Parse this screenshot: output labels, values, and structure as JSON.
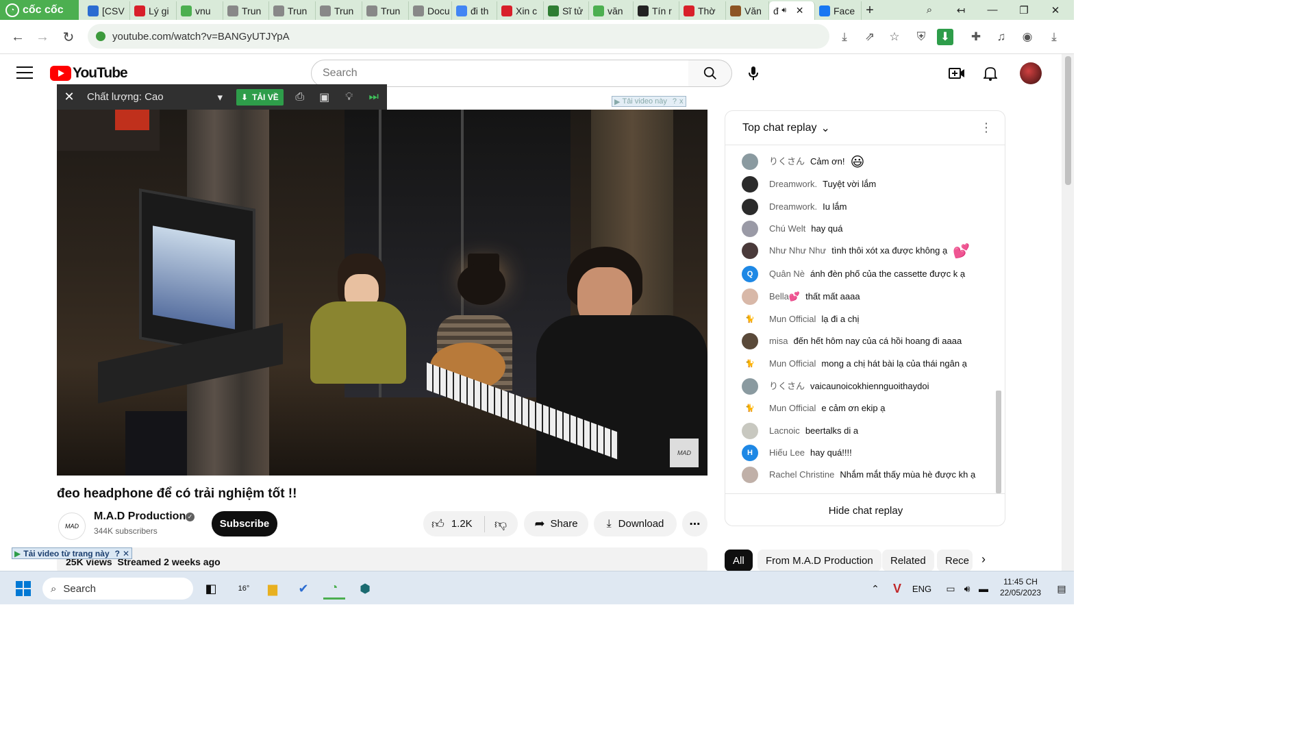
{
  "browser": {
    "brand": "cốc cốc",
    "tabs": [
      {
        "label": "[CSV",
        "icon_color": "#2b6cd1",
        "icon": "doc-icon"
      },
      {
        "label": "Lý gi",
        "icon_color": "#d8202a",
        "icon": "bookmark-icon"
      },
      {
        "label": "vnu",
        "icon_color": "#4caf50",
        "icon": "coccoc-icon"
      },
      {
        "label": "Trun",
        "icon_color": "#888888",
        "icon": "globe-icon"
      },
      {
        "label": "Trun",
        "icon_color": "#888888",
        "icon": "globe-icon"
      },
      {
        "label": "Trun",
        "icon_color": "#888888",
        "icon": "globe-icon"
      },
      {
        "label": "Trun",
        "icon_color": "#888888",
        "icon": "globe-icon"
      },
      {
        "label": "Docu",
        "icon_color": "#888888",
        "icon": "globe-icon"
      },
      {
        "label": "đi th",
        "icon_color": "#4285f4",
        "icon": "google-icon"
      },
      {
        "label": "Xin c",
        "icon_color": "#d8202a",
        "icon": "emblem-icon"
      },
      {
        "label": "Sĩ tử",
        "icon_color": "#2e7d32",
        "icon": "sheet-icon"
      },
      {
        "label": "văn",
        "icon_color": "#4caf50",
        "icon": "coccoc-icon"
      },
      {
        "label": "Tín r",
        "icon_color": "#222222",
        "icon": "wikipedia-icon"
      },
      {
        "label": "Thờ",
        "icon_color": "#d8202a",
        "icon": "emblem-icon"
      },
      {
        "label": "Văn",
        "icon_color": "#8d5524",
        "icon": "figure-icon"
      },
      {
        "label": "đ",
        "icon_color": "#ffffff",
        "icon": "audio-icon"
      },
      {
        "label": "Face",
        "icon_color": "#1877f2",
        "icon": "facebook-icon"
      }
    ],
    "url": "youtube.com/watch?v=BANGyUTJYpA"
  },
  "youtube": {
    "logo_text": "YouTube",
    "search_placeholder": "Search"
  },
  "downloader": {
    "quality": "Chất lượng: Cao",
    "download_label": "TẢI VỀ",
    "small_banner": "Tải video này",
    "page_banner": "Tải video từ trang này"
  },
  "video": {
    "title": "đeo headphone để có trải nghiệm tốt !!",
    "watermark": "MAD",
    "channel_name": "M.A.D Production",
    "channel_avatar_text": "MAD",
    "subscribers": "344K subscribers",
    "subscribe_label": "Subscribe",
    "likes": "1.2K",
    "share_label": "Share",
    "download_label": "Download",
    "views_line": "25K views  Streamed 2 weeks ago"
  },
  "chat": {
    "header": "Top chat replay",
    "footer": "Hide chat replay",
    "messages": [
      {
        "author": "りくさん",
        "text": "Cảm ơn!",
        "emoji": "😃",
        "av_color": "#8a9aa0",
        "av_text": ""
      },
      {
        "author": "Dreamwork.",
        "text": "Tuyệt vời lắm",
        "emoji": "",
        "av_color": "#2b2b2b",
        "av_text": ""
      },
      {
        "author": "Dreamwork.",
        "text": "Iu lắm",
        "emoji": "",
        "av_color": "#2b2b2b",
        "av_text": ""
      },
      {
        "author": "Chú Welt",
        "text": "hay quá",
        "emoji": "",
        "av_color": "#9a9aa6",
        "av_text": ""
      },
      {
        "author": "Như Như Như",
        "text": "tình thôi xót xa được không ạ",
        "emoji": "💕",
        "av_color": "#4a3a3a",
        "av_text": ""
      },
      {
        "author": "Quân Nè",
        "text": "ánh đèn phố của the cassette được k ạ",
        "emoji": "",
        "av_color": "#1e88e5",
        "av_text": "Q"
      },
      {
        "author": "Bella💕",
        "text": "thất mất aaaa",
        "emoji": "",
        "av_color": "#d8b8a8",
        "av_text": ""
      },
      {
        "author": "Mun Official",
        "text": "lạ đi a chị",
        "emoji": "",
        "av_color": "#ffffff",
        "av_text": "🐈"
      },
      {
        "author": "misa",
        "text": "đến hết hôm nay của cá hồi hoang đi aaaa",
        "emoji": "",
        "av_color": "#5a4a3a",
        "av_text": ""
      },
      {
        "author": "Mun Official",
        "text": "mong a chị hát bài lạ của thái ngân ạ",
        "emoji": "",
        "av_color": "#ffffff",
        "av_text": "🐈"
      },
      {
        "author": "りくさん",
        "text": "vaicaunoicokhiennguoithaydoi",
        "emoji": "",
        "av_color": "#8a9aa0",
        "av_text": ""
      },
      {
        "author": "Mun Official",
        "text": "e cảm ơn ekip ạ",
        "emoji": "",
        "av_color": "#ffffff",
        "av_text": "🐈"
      },
      {
        "author": "Lacnoic",
        "text": "beertalks di a",
        "emoji": "",
        "av_color": "#c8c8c0",
        "av_text": ""
      },
      {
        "author": "Hiếu Lee",
        "text": "hay quá!!!!",
        "emoji": "",
        "av_color": "#1e88e5",
        "av_text": "H"
      },
      {
        "author": "Rachel Christine",
        "text": "Nhắm mắt thấy mùa hè được kh ạ",
        "emoji": "",
        "av_color": "#c0b0a8",
        "av_text": ""
      }
    ]
  },
  "chips": [
    "All",
    "From M.A.D Production",
    "Related",
    "Rece"
  ],
  "taskbar": {
    "search_label": "Search",
    "weather": "16°",
    "lang": "ENG",
    "time": "11:45 CH",
    "date": "22/05/2023"
  }
}
